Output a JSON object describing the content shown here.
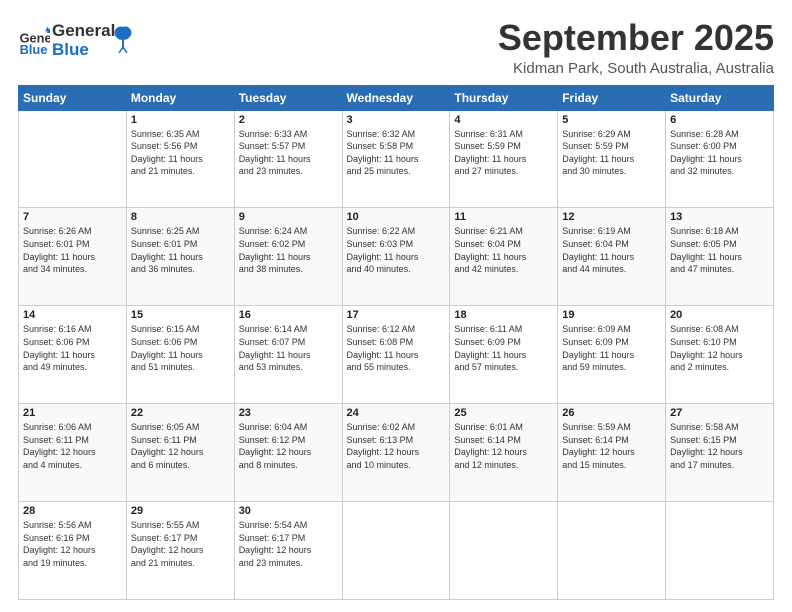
{
  "logo": {
    "line1": "General",
    "line2": "Blue"
  },
  "title": "September 2025",
  "location": "Kidman Park, South Australia, Australia",
  "weekdays": [
    "Sunday",
    "Monday",
    "Tuesday",
    "Wednesday",
    "Thursday",
    "Friday",
    "Saturday"
  ],
  "weeks": [
    [
      {
        "day": "",
        "info": ""
      },
      {
        "day": "1",
        "info": "Sunrise: 6:35 AM\nSunset: 5:56 PM\nDaylight: 11 hours\nand 21 minutes."
      },
      {
        "day": "2",
        "info": "Sunrise: 6:33 AM\nSunset: 5:57 PM\nDaylight: 11 hours\nand 23 minutes."
      },
      {
        "day": "3",
        "info": "Sunrise: 6:32 AM\nSunset: 5:58 PM\nDaylight: 11 hours\nand 25 minutes."
      },
      {
        "day": "4",
        "info": "Sunrise: 6:31 AM\nSunset: 5:59 PM\nDaylight: 11 hours\nand 27 minutes."
      },
      {
        "day": "5",
        "info": "Sunrise: 6:29 AM\nSunset: 5:59 PM\nDaylight: 11 hours\nand 30 minutes."
      },
      {
        "day": "6",
        "info": "Sunrise: 6:28 AM\nSunset: 6:00 PM\nDaylight: 11 hours\nand 32 minutes."
      }
    ],
    [
      {
        "day": "7",
        "info": "Sunrise: 6:26 AM\nSunset: 6:01 PM\nDaylight: 11 hours\nand 34 minutes."
      },
      {
        "day": "8",
        "info": "Sunrise: 6:25 AM\nSunset: 6:01 PM\nDaylight: 11 hours\nand 36 minutes."
      },
      {
        "day": "9",
        "info": "Sunrise: 6:24 AM\nSunset: 6:02 PM\nDaylight: 11 hours\nand 38 minutes."
      },
      {
        "day": "10",
        "info": "Sunrise: 6:22 AM\nSunset: 6:03 PM\nDaylight: 11 hours\nand 40 minutes."
      },
      {
        "day": "11",
        "info": "Sunrise: 6:21 AM\nSunset: 6:04 PM\nDaylight: 11 hours\nand 42 minutes."
      },
      {
        "day": "12",
        "info": "Sunrise: 6:19 AM\nSunset: 6:04 PM\nDaylight: 11 hours\nand 44 minutes."
      },
      {
        "day": "13",
        "info": "Sunrise: 6:18 AM\nSunset: 6:05 PM\nDaylight: 11 hours\nand 47 minutes."
      }
    ],
    [
      {
        "day": "14",
        "info": "Sunrise: 6:16 AM\nSunset: 6:06 PM\nDaylight: 11 hours\nand 49 minutes."
      },
      {
        "day": "15",
        "info": "Sunrise: 6:15 AM\nSunset: 6:06 PM\nDaylight: 11 hours\nand 51 minutes."
      },
      {
        "day": "16",
        "info": "Sunrise: 6:14 AM\nSunset: 6:07 PM\nDaylight: 11 hours\nand 53 minutes."
      },
      {
        "day": "17",
        "info": "Sunrise: 6:12 AM\nSunset: 6:08 PM\nDaylight: 11 hours\nand 55 minutes."
      },
      {
        "day": "18",
        "info": "Sunrise: 6:11 AM\nSunset: 6:09 PM\nDaylight: 11 hours\nand 57 minutes."
      },
      {
        "day": "19",
        "info": "Sunrise: 6:09 AM\nSunset: 6:09 PM\nDaylight: 11 hours\nand 59 minutes."
      },
      {
        "day": "20",
        "info": "Sunrise: 6:08 AM\nSunset: 6:10 PM\nDaylight: 12 hours\nand 2 minutes."
      }
    ],
    [
      {
        "day": "21",
        "info": "Sunrise: 6:06 AM\nSunset: 6:11 PM\nDaylight: 12 hours\nand 4 minutes."
      },
      {
        "day": "22",
        "info": "Sunrise: 6:05 AM\nSunset: 6:11 PM\nDaylight: 12 hours\nand 6 minutes."
      },
      {
        "day": "23",
        "info": "Sunrise: 6:04 AM\nSunset: 6:12 PM\nDaylight: 12 hours\nand 8 minutes."
      },
      {
        "day": "24",
        "info": "Sunrise: 6:02 AM\nSunset: 6:13 PM\nDaylight: 12 hours\nand 10 minutes."
      },
      {
        "day": "25",
        "info": "Sunrise: 6:01 AM\nSunset: 6:14 PM\nDaylight: 12 hours\nand 12 minutes."
      },
      {
        "day": "26",
        "info": "Sunrise: 5:59 AM\nSunset: 6:14 PM\nDaylight: 12 hours\nand 15 minutes."
      },
      {
        "day": "27",
        "info": "Sunrise: 5:58 AM\nSunset: 6:15 PM\nDaylight: 12 hours\nand 17 minutes."
      }
    ],
    [
      {
        "day": "28",
        "info": "Sunrise: 5:56 AM\nSunset: 6:16 PM\nDaylight: 12 hours\nand 19 minutes."
      },
      {
        "day": "29",
        "info": "Sunrise: 5:55 AM\nSunset: 6:17 PM\nDaylight: 12 hours\nand 21 minutes."
      },
      {
        "day": "30",
        "info": "Sunrise: 5:54 AM\nSunset: 6:17 PM\nDaylight: 12 hours\nand 23 minutes."
      },
      {
        "day": "",
        "info": ""
      },
      {
        "day": "",
        "info": ""
      },
      {
        "day": "",
        "info": ""
      },
      {
        "day": "",
        "info": ""
      }
    ]
  ]
}
